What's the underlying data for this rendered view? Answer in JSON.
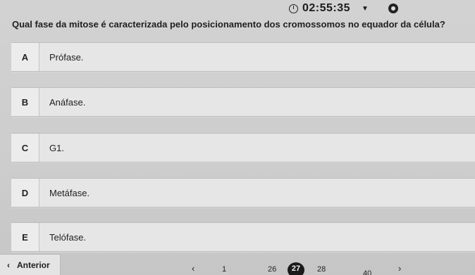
{
  "header": {
    "timer": "02:55:35"
  },
  "question": {
    "text": "Qual fase da mitose é caracterizada pelo posicionamento dos cromossomos no equador da célula?"
  },
  "options": [
    {
      "letter": "A",
      "text": "Prófase."
    },
    {
      "letter": "B",
      "text": "Anáfase."
    },
    {
      "letter": "C",
      "text": "G1."
    },
    {
      "letter": "D",
      "text": "Metáfase."
    },
    {
      "letter": "E",
      "text": "Telófase."
    }
  ],
  "footer": {
    "prev_label": "Anterior",
    "pages": [
      "1",
      "26",
      "27",
      "28",
      "40"
    ],
    "current_page": "27"
  }
}
